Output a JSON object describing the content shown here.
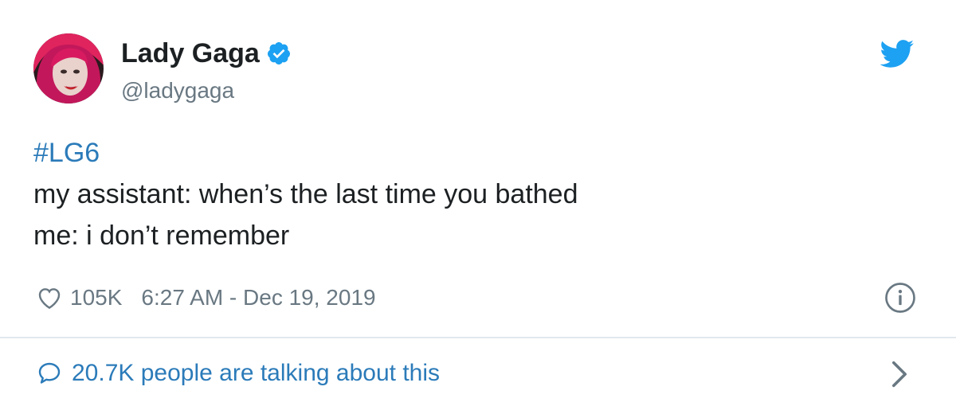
{
  "author": {
    "display_name": "Lady Gaga",
    "handle": "@ladygaga",
    "verified": true
  },
  "tweet": {
    "hashtag": "#LG6",
    "lines": [
      "my assistant: when’s the last time you bathed",
      "me: i don’t remember"
    ]
  },
  "meta": {
    "likes": "105K",
    "timestamp": "6:27 AM - Dec 19, 2019"
  },
  "footer": {
    "talking": "20.7K people are talking about this"
  },
  "icons": {
    "brand": "twitter-bird-icon",
    "like": "heart-icon",
    "info": "info-icon",
    "reply": "speech-bubble-icon",
    "more": "chevron-right-icon"
  },
  "colors": {
    "link": "#2b7bb9",
    "twitter_blue": "#1da1f2",
    "muted": "#697882",
    "text": "#1c2022",
    "divider": "#e1e8ed"
  }
}
